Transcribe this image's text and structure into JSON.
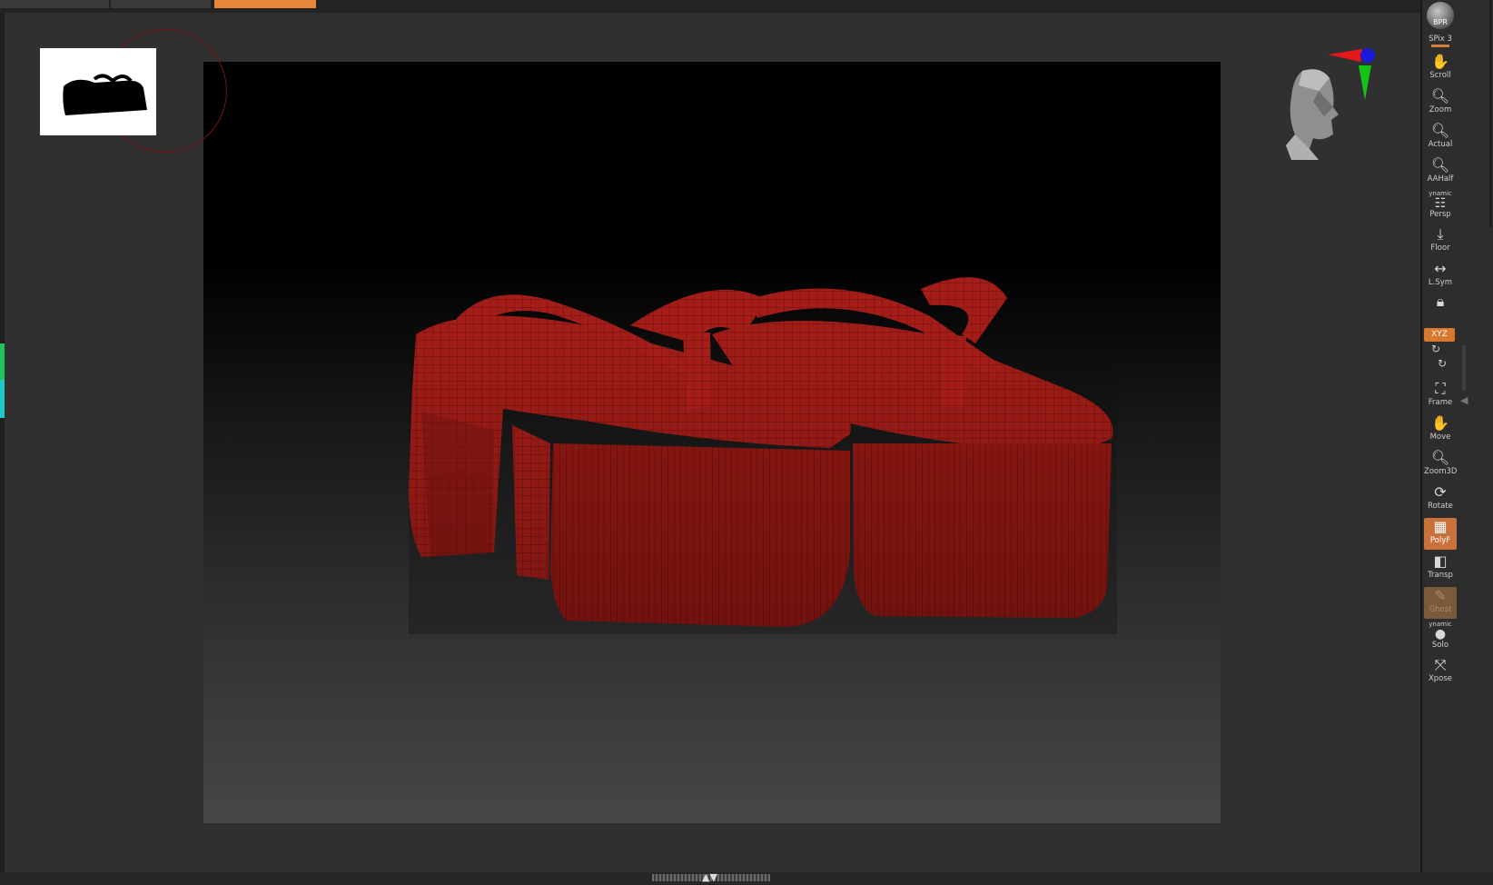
{
  "window": {
    "title": ""
  },
  "top_tabs": [
    {
      "name": "tab-1",
      "color": "#3a3a3a"
    },
    {
      "name": "tab-2",
      "color": "#3a3a3a"
    },
    {
      "name": "tab-3-active",
      "color": "#e8873a"
    }
  ],
  "thumbnail": {
    "icon": "sandals-silhouette-thumbnail"
  },
  "viewport": {
    "model": "geta-sandals-wireframe",
    "mesh_color": "#a51d18",
    "wire_color": "#5a0d0a"
  },
  "nav_widget": {
    "icon": "head-orientation-icon"
  },
  "axis_widget": {
    "x_color": "#e31919",
    "y_color": "#16c216",
    "z_color": "#1a1ad8"
  },
  "right_shelf": {
    "bpr": {
      "label": "BPR"
    },
    "spix": {
      "label": "SPix 3"
    },
    "scroll": {
      "label": "Scroll"
    },
    "zoom": {
      "label": "Zoom"
    },
    "actual": {
      "label": "Actual"
    },
    "aahalf": {
      "label": "AAHalf"
    },
    "persp": {
      "label": "Persp",
      "top": "ynamic"
    },
    "floor": {
      "label": "Floor"
    },
    "lsym": {
      "label": "L.Sym"
    },
    "lock": {
      "label": ""
    },
    "xyz": {
      "label": "XYZ"
    },
    "frame": {
      "label": "Frame"
    },
    "move": {
      "label": "Move"
    },
    "zoom3d": {
      "label": "Zoom3D"
    },
    "rotate": {
      "label": "Rotate"
    },
    "polyf": {
      "label": "PolyF"
    },
    "transp": {
      "label": "Transp"
    },
    "ghost": {
      "label": "Ghost"
    },
    "solo": {
      "label": "Solo",
      "top": "ynamic"
    },
    "xpose": {
      "label": "Xpose"
    }
  },
  "accent_color": "#d8782f"
}
